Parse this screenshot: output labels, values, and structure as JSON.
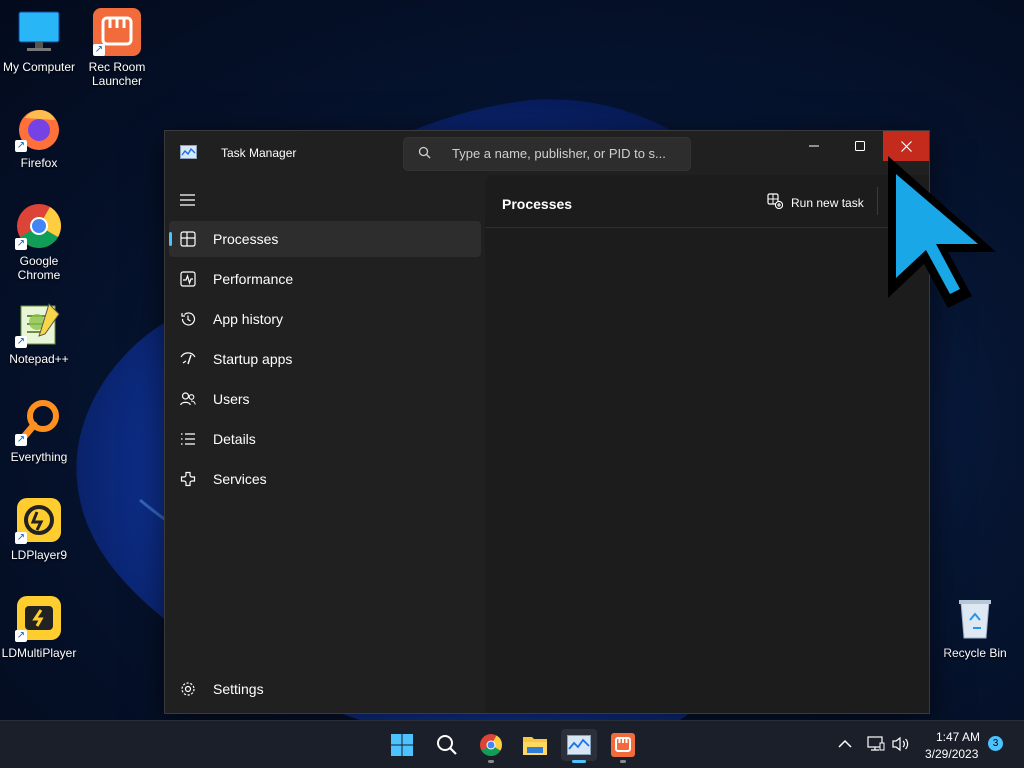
{
  "desktop": {
    "icons": [
      {
        "label": "My Computer"
      },
      {
        "label": "Rec Room Launcher"
      },
      {
        "label": "Firefox"
      },
      {
        "label": "Google Chrome"
      },
      {
        "label": "Notepad++"
      },
      {
        "label": "Everything"
      },
      {
        "label": "LDPlayer9"
      },
      {
        "label": "LDMultiPlayer"
      },
      {
        "label": "Recycle Bin"
      }
    ]
  },
  "window": {
    "title": "Task Manager",
    "search_placeholder": "Type a name, publisher, or PID to s...",
    "close_color": "#c42b1c"
  },
  "sidebar": {
    "items": [
      {
        "label": "Processes",
        "icon": "processes-icon",
        "active": true
      },
      {
        "label": "Performance",
        "icon": "performance-icon"
      },
      {
        "label": "App history",
        "icon": "history-icon"
      },
      {
        "label": "Startup apps",
        "icon": "startup-icon"
      },
      {
        "label": "Users",
        "icon": "users-icon"
      },
      {
        "label": "Details",
        "icon": "details-icon"
      },
      {
        "label": "Services",
        "icon": "services-icon"
      }
    ],
    "settings_label": "Settings"
  },
  "main": {
    "title": "Processes",
    "run_task_label": "Run new task"
  },
  "taskbar": {
    "time": "1:47 AM",
    "date": "3/29/2023",
    "notification_count": "3"
  },
  "colors": {
    "accent": "#4cc2ff",
    "window_bg": "#202020"
  }
}
